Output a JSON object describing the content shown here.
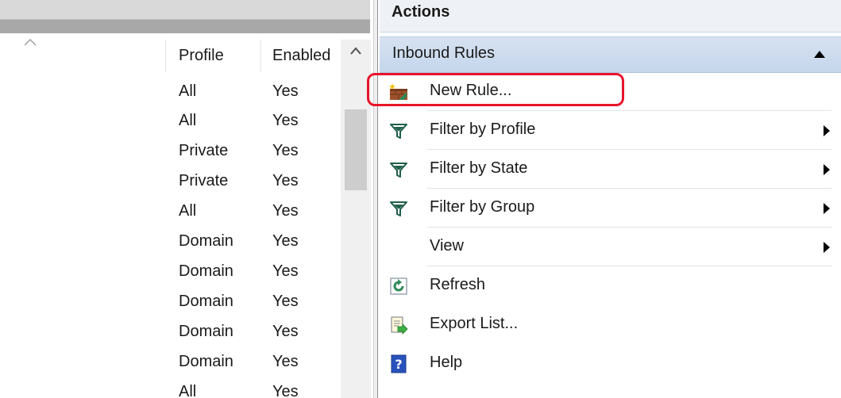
{
  "rules_list": {
    "columns": [
      "Profile",
      "Enabled"
    ],
    "rows": [
      {
        "profile": "All",
        "enabled": "Yes"
      },
      {
        "profile": "All",
        "enabled": "Yes"
      },
      {
        "profile": "Private",
        "enabled": "Yes"
      },
      {
        "profile": "Private",
        "enabled": "Yes"
      },
      {
        "profile": "All",
        "enabled": "Yes"
      },
      {
        "profile": "Domain",
        "enabled": "Yes"
      },
      {
        "profile": "Domain",
        "enabled": "Yes"
      },
      {
        "profile": "Domain",
        "enabled": "Yes"
      },
      {
        "profile": "Domain",
        "enabled": "Yes"
      },
      {
        "profile": "Domain",
        "enabled": "Yes"
      },
      {
        "profile": "All",
        "enabled": "Yes"
      }
    ]
  },
  "actions": {
    "title": "Actions",
    "section": "Inbound Rules",
    "items": [
      {
        "label": "New Rule...",
        "icon": "new-rule-icon",
        "submenu": false
      },
      {
        "label": "Filter by Profile",
        "icon": "filter-icon",
        "submenu": true
      },
      {
        "label": "Filter by State",
        "icon": "filter-icon",
        "submenu": true
      },
      {
        "label": "Filter by Group",
        "icon": "filter-icon",
        "submenu": true
      },
      {
        "label": "View",
        "icon": "",
        "submenu": true
      },
      {
        "label": "Refresh",
        "icon": "refresh-icon",
        "submenu": false
      },
      {
        "label": "Export List...",
        "icon": "export-icon",
        "submenu": false
      },
      {
        "label": "Help",
        "icon": "help-icon",
        "submenu": false
      }
    ]
  },
  "colors": {
    "highlight": "#e8142b",
    "section_header": "#c5d6ec",
    "filter_icon": "#1f5f4a",
    "help_icon": "#2a52be",
    "refresh_icon": "#2e8b57"
  }
}
